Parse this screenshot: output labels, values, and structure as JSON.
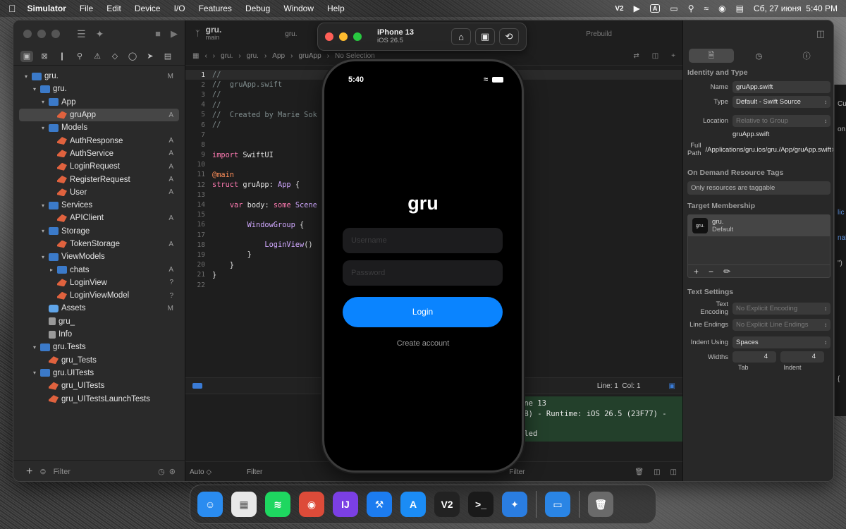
{
  "menubar": {
    "app_name": "Simulator",
    "items": [
      "File",
      "Edit",
      "Device",
      "I/O",
      "Features",
      "Debug",
      "Window",
      "Help"
    ],
    "v2_badge": "V2",
    "a_badge": "A",
    "datetime": "Сб, 27 июня  5:40 PM"
  },
  "xcode": {
    "navigator": {
      "tree": [
        {
          "label": "gru.",
          "badge": "M",
          "indent": 0,
          "icon": "project",
          "chev": "open"
        },
        {
          "label": "gru.",
          "badge": "",
          "indent": 1,
          "icon": "folder",
          "chev": "open"
        },
        {
          "label": "App",
          "badge": "",
          "indent": 2,
          "icon": "folder",
          "chev": "open"
        },
        {
          "label": "gruApp",
          "badge": "A",
          "indent": 3,
          "icon": "swift",
          "chev": "",
          "selected": true
        },
        {
          "label": "Models",
          "badge": "",
          "indent": 2,
          "icon": "folder",
          "chev": "open"
        },
        {
          "label": "AuthResponse",
          "badge": "A",
          "indent": 3,
          "icon": "swift",
          "chev": ""
        },
        {
          "label": "AuthService",
          "badge": "A",
          "indent": 3,
          "icon": "swift",
          "chev": ""
        },
        {
          "label": "LoginRequest",
          "badge": "A",
          "indent": 3,
          "icon": "swift",
          "chev": ""
        },
        {
          "label": "RegisterRequest",
          "badge": "A",
          "indent": 3,
          "icon": "swift",
          "chev": ""
        },
        {
          "label": "User",
          "badge": "A",
          "indent": 3,
          "icon": "swift",
          "chev": ""
        },
        {
          "label": "Services",
          "badge": "",
          "indent": 2,
          "icon": "folder",
          "chev": "open"
        },
        {
          "label": "APIClient",
          "badge": "A",
          "indent": 3,
          "icon": "swift",
          "chev": ""
        },
        {
          "label": "Storage",
          "badge": "",
          "indent": 2,
          "icon": "folder",
          "chev": "open"
        },
        {
          "label": "TokenStorage",
          "badge": "A",
          "indent": 3,
          "icon": "swift",
          "chev": ""
        },
        {
          "label": "ViewModels",
          "badge": "",
          "indent": 2,
          "icon": "folder",
          "chev": "open"
        },
        {
          "label": "chats",
          "badge": "A",
          "indent": 3,
          "icon": "folder",
          "chev": "closed"
        },
        {
          "label": "LoginView",
          "badge": "?",
          "indent": 3,
          "icon": "swift",
          "chev": ""
        },
        {
          "label": "LoginViewModel",
          "badge": "?",
          "indent": 3,
          "icon": "swift",
          "chev": ""
        },
        {
          "label": "Assets",
          "badge": "M",
          "indent": 2,
          "icon": "assets",
          "chev": ""
        },
        {
          "label": "gru_",
          "badge": "",
          "indent": 2,
          "icon": "file",
          "chev": ""
        },
        {
          "label": "Info",
          "badge": "",
          "indent": 2,
          "icon": "file",
          "chev": ""
        },
        {
          "label": "gru.Tests",
          "badge": "",
          "indent": 1,
          "icon": "test",
          "chev": "open"
        },
        {
          "label": "gru_Tests",
          "badge": "",
          "indent": 2,
          "icon": "swift",
          "chev": ""
        },
        {
          "label": "gru.UITests",
          "badge": "",
          "indent": 1,
          "icon": "test",
          "chev": "open"
        },
        {
          "label": "gru_UITests",
          "badge": "",
          "indent": 2,
          "icon": "swift",
          "chev": ""
        },
        {
          "label": "gru_UITestsLaunchTests",
          "badge": "",
          "indent": 2,
          "icon": "swift",
          "chev": ""
        }
      ],
      "filter_placeholder": "Filter"
    },
    "toolbar": {
      "project": "gru.",
      "branch": "main",
      "tab_label": "gru.",
      "prebuild": "Prebuild"
    },
    "jumpbar": [
      "gru.",
      "gru.",
      "App",
      "gruApp",
      "No Selection"
    ],
    "code_lines": [
      [
        {
          "t": "//",
          "c": "comment"
        }
      ],
      [
        {
          "t": "//  gruApp.swift",
          "c": "comment"
        }
      ],
      [
        {
          "t": "//",
          "c": "comment"
        }
      ],
      [
        {
          "t": "//",
          "c": "comment"
        }
      ],
      [
        {
          "t": "//  Created by Marie Sok",
          "c": "comment"
        }
      ],
      [
        {
          "t": "//",
          "c": "comment"
        }
      ],
      [
        {
          "t": "",
          "c": "plain"
        }
      ],
      [
        {
          "t": "",
          "c": "plain"
        }
      ],
      [
        {
          "t": "import ",
          "c": "kw"
        },
        {
          "t": "SwiftUI",
          "c": "plain"
        }
      ],
      [
        {
          "t": "",
          "c": "plain"
        }
      ],
      [
        {
          "t": "@main",
          "c": "attr"
        }
      ],
      [
        {
          "t": "struct ",
          "c": "kw"
        },
        {
          "t": "gruApp",
          "c": "plain"
        },
        {
          "t": ": ",
          "c": "plain"
        },
        {
          "t": "App",
          "c": "type"
        },
        {
          "t": " {",
          "c": "plain"
        }
      ],
      [
        {
          "t": "",
          "c": "plain"
        }
      ],
      [
        {
          "t": "    ",
          "c": "plain"
        },
        {
          "t": "var ",
          "c": "kw"
        },
        {
          "t": "body",
          "c": "plain"
        },
        {
          "t": ": ",
          "c": "plain"
        },
        {
          "t": "some ",
          "c": "kw"
        },
        {
          "t": "Scene",
          "c": "type"
        }
      ],
      [
        {
          "t": "",
          "c": "plain"
        }
      ],
      [
        {
          "t": "        ",
          "c": "plain"
        },
        {
          "t": "WindowGroup",
          "c": "type"
        },
        {
          "t": " {",
          "c": "plain"
        }
      ],
      [
        {
          "t": "",
          "c": "plain"
        }
      ],
      [
        {
          "t": "            ",
          "c": "plain"
        },
        {
          "t": "LoginView",
          "c": "type"
        },
        {
          "t": "()",
          "c": "plain"
        }
      ],
      [
        {
          "t": "        }",
          "c": "plain"
        }
      ],
      [
        {
          "t": "    }",
          "c": "plain"
        }
      ],
      [
        {
          "t": "}",
          "c": "plain"
        }
      ],
      [
        {
          "t": "",
          "c": "plain"
        }
      ]
    ],
    "status": {
      "position": "Line: 1  Col: 1"
    },
    "console_lines": [
      "one 13",
      "AB) - Runtime: iOS 26.5 (23F77) -",
      "",
      "lled"
    ],
    "editor_bottom": {
      "auto": "Auto ◇",
      "filter": "Filter",
      "filter2": "Filter"
    },
    "inspector": {
      "identity_title": "Identity and Type",
      "name_label": "Name",
      "name_value": "gruApp.swift",
      "type_label": "Type",
      "type_value": "Default - Swift Source",
      "location_label": "Location",
      "location_value": "Relative to Group",
      "location_file": "gruApp.swift",
      "fullpath_label": "Full Path",
      "fullpath_value": "/Applications/gru.ios/gru./App/gruApp.swift",
      "odr_title": "On Demand Resource Tags",
      "odr_value": "Only resources are taggable",
      "target_title": "Target Membership",
      "target_icon": "gru.",
      "target_name": "gru.",
      "target_sub": "Default",
      "text_title": "Text Settings",
      "encoding_label": "Text Encoding",
      "encoding_value": "No Explicit Encoding",
      "endings_label": "Line Endings",
      "endings_value": "No Explicit Line Endings",
      "indent_label": "Indent Using",
      "indent_value": "Spaces",
      "widths_label": "Widths",
      "tab_width": "4",
      "indent_width": "4",
      "tab_label": "Tab",
      "indent_label2": "Indent"
    }
  },
  "simulator": {
    "device": "iPhone 13",
    "os": "iOS 26.5",
    "time": "5:40",
    "app_title": "gru",
    "username_placeholder": "Username",
    "password_placeholder": "Password",
    "login_label": "Login",
    "create_label": "Create account"
  },
  "bg_window_texts": [
    "Cu",
    "on.h",
    "lic",
    "nab",
    "\")",
    "{"
  ],
  "dock_apps": [
    {
      "name": "Finder",
      "color": "#2a8cf0",
      "glyph": "☺"
    },
    {
      "name": "Launchpad",
      "color": "#e8e8e8",
      "glyph": "▦"
    },
    {
      "name": "Spotify",
      "color": "#1ed760",
      "glyph": "≋"
    },
    {
      "name": "Chrome",
      "color": "#dd4b39",
      "glyph": "◉"
    },
    {
      "name": "IntelliJ",
      "color": "#7b3fe4",
      "glyph": "IJ"
    },
    {
      "name": "Xcode",
      "color": "#1c7cf0",
      "glyph": "⚒"
    },
    {
      "name": "App Store",
      "color": "#1b8cf5",
      "glyph": "A"
    },
    {
      "name": "V2",
      "color": "#222222",
      "glyph": "V2"
    },
    {
      "name": "Terminal",
      "color": "#1a1a1a",
      "glyph": ">_"
    },
    {
      "name": "Safari",
      "color": "#2a7de1",
      "glyph": "✦"
    },
    {
      "name": "Simulator",
      "color": "#2a85e5",
      "glyph": "▭"
    }
  ]
}
